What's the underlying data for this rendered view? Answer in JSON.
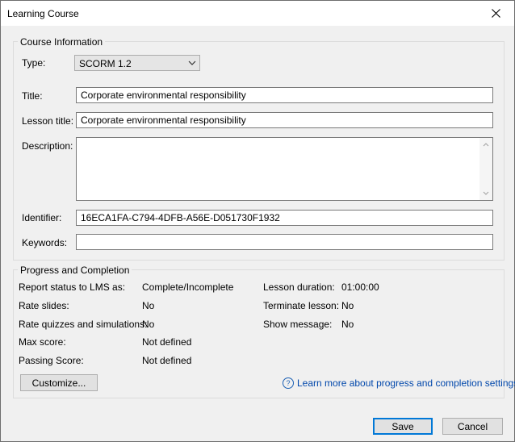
{
  "window": {
    "title": "Learning Course"
  },
  "course_info": {
    "group_label": "Course Information",
    "type_label": "Type:",
    "type_value": "SCORM 1.2",
    "title_label": "Title:",
    "title_value": "Corporate environmental responsibility",
    "lesson_title_label": "Lesson title:",
    "lesson_title_value": "Corporate environmental responsibility",
    "description_label": "Description:",
    "description_value": "",
    "identifier_label": "Identifier:",
    "identifier_value": "16ECA1FA-C794-4DFB-A56E-D051730F1932",
    "keywords_label": "Keywords:",
    "keywords_value": ""
  },
  "progress": {
    "group_label": "Progress and Completion",
    "report_status_label": "Report status to LMS as:",
    "report_status_value": "Complete/Incomplete",
    "rate_slides_label": "Rate slides:",
    "rate_slides_value": "No",
    "rate_quizzes_label": "Rate quizzes and simulations:",
    "rate_quizzes_value": "No",
    "max_score_label": "Max score:",
    "max_score_value": "Not defined",
    "passing_score_label": "Passing Score:",
    "passing_score_value": "Not defined",
    "lesson_duration_label": "Lesson duration:",
    "lesson_duration_value": "01:00:00",
    "terminate_lesson_label": "Terminate lesson:",
    "terminate_lesson_value": "No",
    "show_message_label": "Show message:",
    "show_message_value": "No",
    "customize_label": "Customize...",
    "learn_more_label": "Learn more about progress and completion settings"
  },
  "footer": {
    "save_label": "Save",
    "cancel_label": "Cancel"
  },
  "colors": {
    "accent": "#0078d7",
    "link": "#0047ab"
  }
}
